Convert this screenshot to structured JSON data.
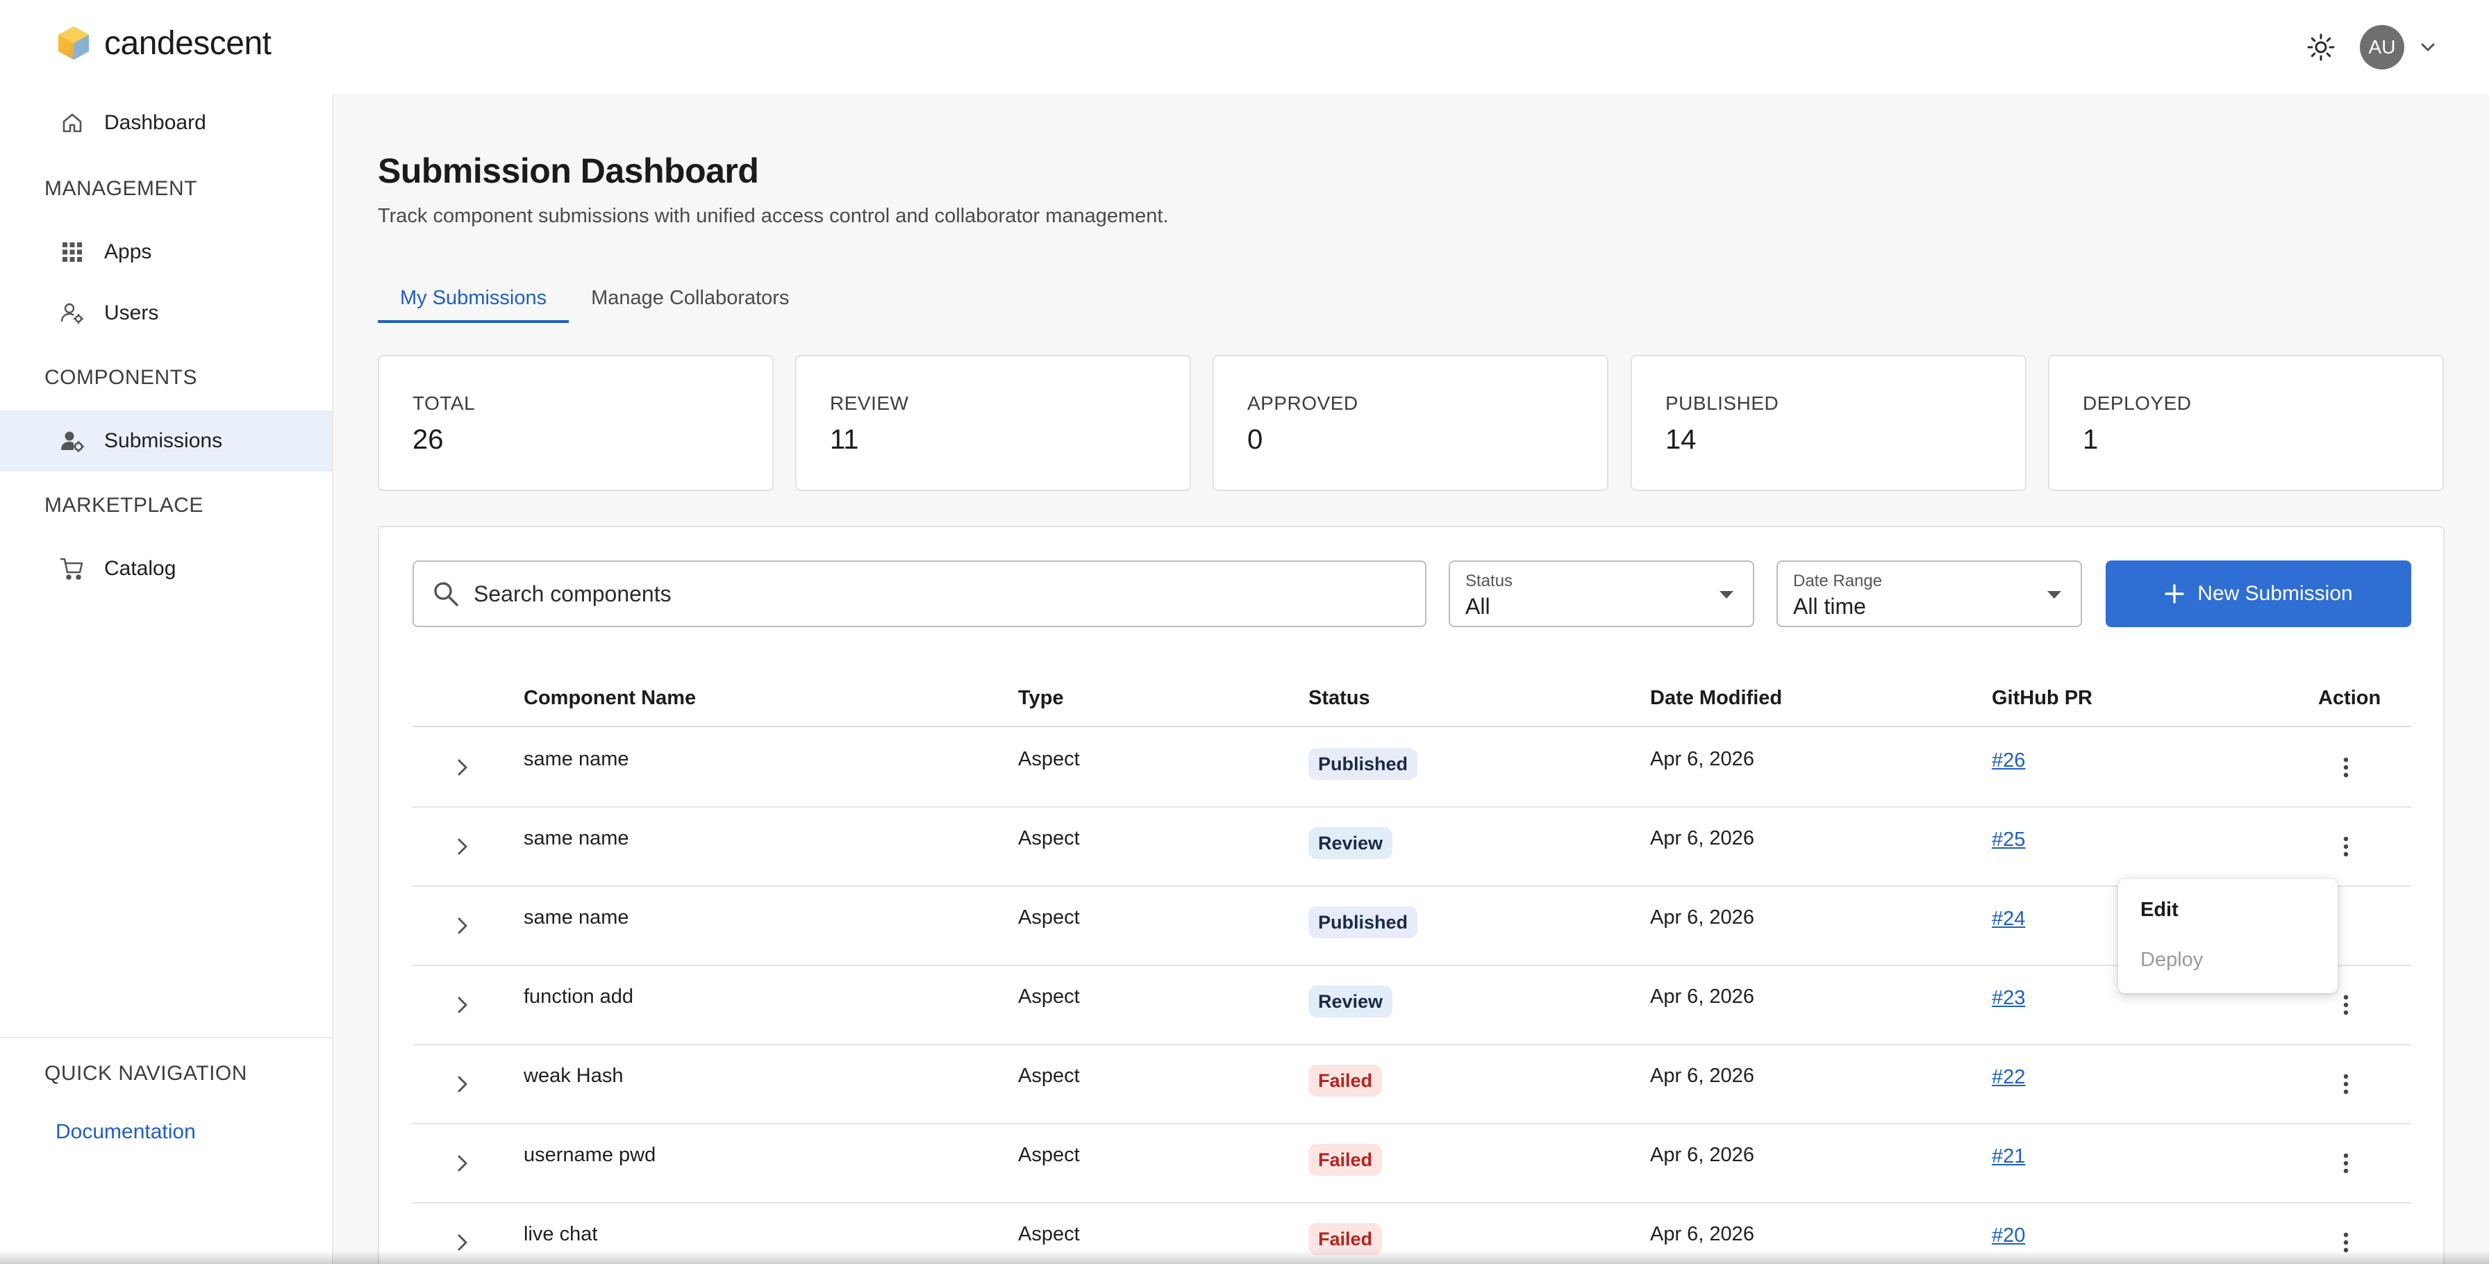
{
  "brand": {
    "name": "candescent"
  },
  "header": {
    "avatar_initials": "AU"
  },
  "sidebar": {
    "dashboard": "Dashboard",
    "sections": {
      "management": "MANAGEMENT",
      "components": "COMPONENTS",
      "marketplace": "MARKETPLACE",
      "quick_navigation": "QUICK NAVIGATION"
    },
    "items": {
      "apps": "Apps",
      "users": "Users",
      "submissions": "Submissions",
      "catalog": "Catalog"
    },
    "documentation": "Documentation"
  },
  "page": {
    "title": "Submission Dashboard",
    "subtitle": "Track component submissions with unified access control and collaborator management."
  },
  "tabs": [
    "My Submissions",
    "Manage Collaborators"
  ],
  "stats": [
    {
      "label": "TOTAL",
      "value": "26"
    },
    {
      "label": "REVIEW",
      "value": "11"
    },
    {
      "label": "APPROVED",
      "value": "0"
    },
    {
      "label": "PUBLISHED",
      "value": "14"
    },
    {
      "label": "DEPLOYED",
      "value": "1"
    }
  ],
  "search": {
    "placeholder": "Search components"
  },
  "filters": {
    "status": {
      "label": "Status",
      "value": "All"
    },
    "date_range": {
      "label": "Date Range",
      "value": "All time"
    }
  },
  "new_button": "New Submission",
  "table": {
    "columns": [
      "Component Name",
      "Type",
      "Status",
      "Date Modified",
      "GitHub PR",
      "Action"
    ],
    "rows": [
      {
        "name": "same name",
        "type": "Aspect",
        "status": "Published",
        "date": "Apr 6, 2026",
        "pr": "#26"
      },
      {
        "name": "same name",
        "type": "Aspect",
        "status": "Review",
        "date": "Apr 6, 2026",
        "pr": "#25"
      },
      {
        "name": "same name",
        "type": "Aspect",
        "status": "Published",
        "date": "Apr 6, 2026",
        "pr": "#24"
      },
      {
        "name": "function add",
        "type": "Aspect",
        "status": "Review",
        "date": "Apr 6, 2026",
        "pr": "#23"
      },
      {
        "name": "weak Hash",
        "type": "Aspect",
        "status": "Failed",
        "date": "Apr 6, 2026",
        "pr": "#22"
      },
      {
        "name": "username pwd",
        "type": "Aspect",
        "status": "Failed",
        "date": "Apr 6, 2026",
        "pr": "#21"
      },
      {
        "name": "live chat",
        "type": "Aspect",
        "status": "Failed",
        "date": "Apr 6, 2026",
        "pr": "#20"
      }
    ]
  },
  "context_menu": {
    "edit": "Edit",
    "deploy": "Deploy"
  },
  "colors": {
    "accent": "#2f6ed3",
    "link": "#1f5fbf",
    "active_nav": "#eaf0fa",
    "failed_bg": "#fbe4e4",
    "failed_text": "#b3261e",
    "badge_bg": "#e7ecf8"
  }
}
